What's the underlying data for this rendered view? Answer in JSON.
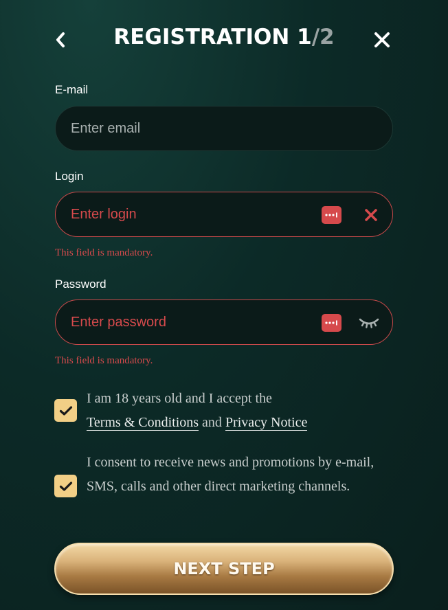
{
  "header": {
    "title": "REGISTRATION 1",
    "step_separator": "/",
    "step_total": "2"
  },
  "fields": {
    "email": {
      "label": "E-mail",
      "placeholder": "Enter email",
      "value": ""
    },
    "login": {
      "label": "Login",
      "placeholder": "Enter login",
      "value": "",
      "error": "This field is mandatory."
    },
    "password": {
      "label": "Password",
      "placeholder": "Enter password",
      "value": "",
      "error": "This field is mandatory."
    }
  },
  "consents": {
    "terms": {
      "checked": true,
      "text_before": "I am 18 years old and I accept the",
      "terms_link": "Terms & Conditions",
      "conjunction": "and",
      "privacy_link": "Privacy Notice"
    },
    "marketing": {
      "checked": true,
      "text": "I consent to receive news and promotions by e-mail, SMS, calls and other direct marketing channels."
    }
  },
  "actions": {
    "next_label": "NEXT STEP"
  },
  "colors": {
    "error": "#d64a4c",
    "checkbox": "#f2cf86",
    "background": "#0c2a27"
  },
  "icons": {
    "back": "chevron-left-icon",
    "close": "close-icon",
    "password_manager": "password-manager-icon",
    "clear": "clear-icon",
    "visibility": "eye-closed-icon",
    "check": "checkmark-icon"
  }
}
